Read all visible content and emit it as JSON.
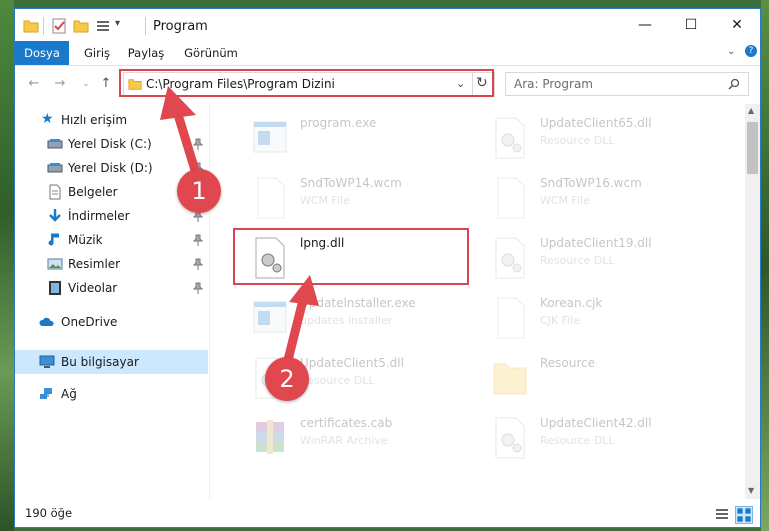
{
  "window": {
    "title": "Program"
  },
  "ribbon": {
    "tabs": [
      "Dosya",
      "Giriş",
      "Paylaş",
      "Görünüm"
    ]
  },
  "address": {
    "path": "C:\\Program Files\\Program Dizini"
  },
  "search": {
    "placeholder": "Ara: Program"
  },
  "sidebar": {
    "quick_access": "Hızlı erişim",
    "items": [
      {
        "label": "Yerel Disk (C:)",
        "icon": "drive-icon",
        "pinned": true
      },
      {
        "label": "Yerel Disk (D:)",
        "icon": "drive-icon",
        "pinned": true
      },
      {
        "label": "Belgeler",
        "icon": "documents-icon",
        "pinned": true
      },
      {
        "label": "İndirmeler",
        "icon": "downloads-icon",
        "pinned": true
      },
      {
        "label": "Müzik",
        "icon": "music-icon",
        "pinned": true
      },
      {
        "label": "Resimler",
        "icon": "pictures-icon",
        "pinned": true
      },
      {
        "label": "Videolar",
        "icon": "videos-icon",
        "pinned": true
      }
    ],
    "onedrive": "OneDrive",
    "this_pc": "Bu bilgisayar",
    "network": "Ağ"
  },
  "files": {
    "left": [
      {
        "name": "program.exe",
        "type": ""
      },
      {
        "name": "SndToWP14.wcm",
        "type": "WCM File"
      },
      {
        "name": "lpng.dll",
        "type": ""
      },
      {
        "name": "Updatelnstaller.exe",
        "type": "updates installer"
      },
      {
        "name": "UpdateClient5.dll",
        "type": "Resource DLL"
      },
      {
        "name": "certificates.cab",
        "type": "WinRAR Archive"
      }
    ],
    "right": [
      {
        "name": "UpdateClient65.dll",
        "type": "Resource DLL"
      },
      {
        "name": "SndToWP16.wcm",
        "type": "WCM File"
      },
      {
        "name": "UpdateClient19.dll",
        "type": "Resource DLL"
      },
      {
        "name": "Korean.cjk",
        "type": "CJK File"
      },
      {
        "name": "Resource",
        "type": ""
      },
      {
        "name": "UpdateClient42.dll",
        "type": "Resource DLL"
      }
    ]
  },
  "status": {
    "count": "190 öğe"
  },
  "annotations": {
    "step1": "1",
    "step2": "2"
  },
  "colors": {
    "accent": "#1979ca",
    "annotation": "#d9464d"
  }
}
